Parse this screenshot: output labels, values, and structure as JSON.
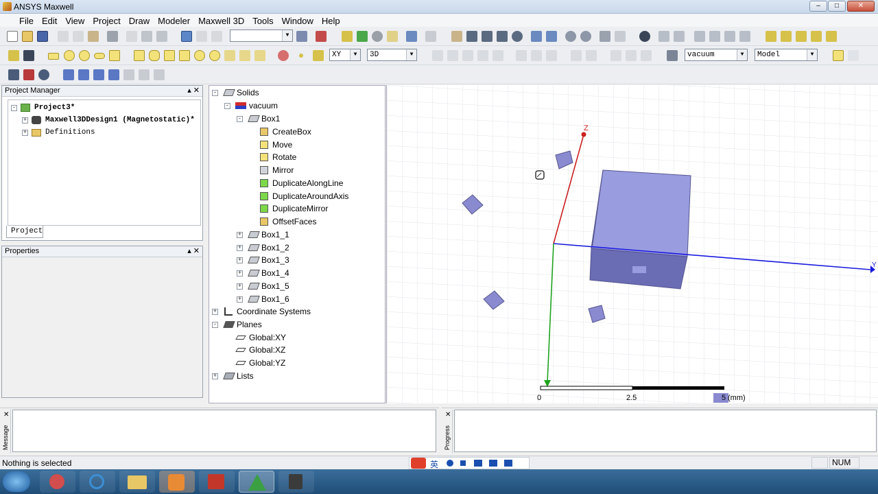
{
  "window": {
    "title": "ANSYS Maxwell",
    "controls": [
      "–",
      "□",
      "✕"
    ]
  },
  "menu": [
    "File",
    "Edit",
    "View",
    "Project",
    "Draw",
    "Modeler",
    "Maxwell 3D",
    "Tools",
    "Window",
    "Help"
  ],
  "toolbar": {
    "plane_select": "XY",
    "mode_select": "3D",
    "material_select": "vacuum",
    "model_select": "Model",
    "empty_select": ""
  },
  "project_manager": {
    "title": "Project Manager",
    "project": "Project3*",
    "design": "Maxwell3DDesign1 (Magnetostatic)*",
    "definitions": "Definitions",
    "tab": "Project"
  },
  "properties": {
    "title": "Properties"
  },
  "model_tree": {
    "solids": "Solids",
    "material": "vacuum",
    "box1": "Box1",
    "ops": [
      "CreateBox",
      "Move",
      "Rotate",
      "Mirror",
      "DuplicateAlongLine",
      "DuplicateAroundAxis",
      "DuplicateMirror",
      "OffsetFaces"
    ],
    "boxes": [
      "Box1_1",
      "Box1_2",
      "Box1_3",
      "Box1_4",
      "Box1_5",
      "Box1_6"
    ],
    "coordinate_systems": "Coordinate Systems",
    "planes": "Planes",
    "plane_items": [
      "Global:XY",
      "Global:XZ",
      "Global:YZ"
    ],
    "lists": "Lists"
  },
  "viewport": {
    "axis_z": "Z",
    "axis_y": "Y",
    "scale_labels": [
      "0",
      "2.5",
      "5"
    ],
    "scale_unit": "(mm)",
    "box_color": "#8a8ad0"
  },
  "message_panel": {
    "label": "Message"
  },
  "progress_panel": {
    "label": "Progress"
  },
  "status": {
    "text": "Nothing is selected",
    "num": "NUM"
  },
  "ime": {
    "lang": "英"
  },
  "colors": {
    "z_axis": "#cc1f1f",
    "y_axis": "#1a1adf",
    "x_axis": "#1fa31f"
  }
}
